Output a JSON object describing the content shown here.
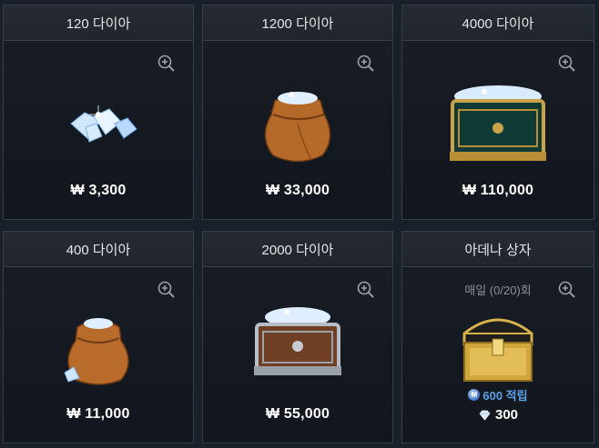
{
  "currency_symbol": "₩",
  "items": [
    {
      "title": "120 다이아",
      "price": "₩ 3,300",
      "image": "diamond-pile"
    },
    {
      "title": "1200 다이아",
      "price": "₩ 33,000",
      "image": "diamond-bag"
    },
    {
      "title": "4000 다이아",
      "price": "₩ 110,000",
      "image": "diamond-chest-gold"
    },
    {
      "title": "400 다이아",
      "price": "₩ 11,000",
      "image": "diamond-sack"
    },
    {
      "title": "2000 다이아",
      "price": "₩ 55,000",
      "image": "diamond-chest-silver"
    },
    {
      "title": "아데나 상자",
      "daily_limit": "매일 (0/20)회",
      "reward": "600 적립",
      "cost": "300",
      "image": "treasure-chest"
    }
  ],
  "colors": {
    "accent_blue": "#5aa2ea",
    "card_bg": "#141820",
    "border": "#383d46"
  }
}
